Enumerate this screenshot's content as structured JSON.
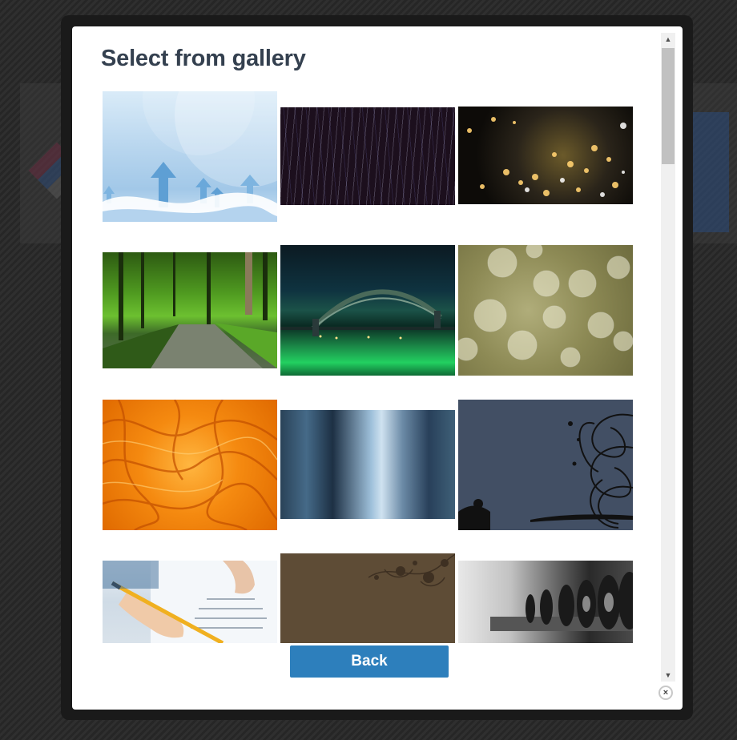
{
  "dialog": {
    "title": "Select from gallery",
    "back_label": "Back",
    "close_icon_glyph": "×"
  },
  "gallery": {
    "images": [
      {
        "subject": "blue-arrows-abstract",
        "icon": "image-icon"
      },
      {
        "subject": "dark-rain-streaks",
        "icon": "image-icon"
      },
      {
        "subject": "city-lights-bokeh-night",
        "icon": "image-icon"
      },
      {
        "subject": "green-forest-path",
        "icon": "image-icon"
      },
      {
        "subject": "harbour-bridge-night-green-water",
        "icon": "image-icon"
      },
      {
        "subject": "olive-bokeh-circles",
        "icon": "image-icon"
      },
      {
        "subject": "orange-abstract-texture",
        "icon": "image-icon"
      },
      {
        "subject": "blue-blurred-stripes",
        "icon": "image-icon"
      },
      {
        "subject": "slate-grunge-swirls",
        "icon": "image-icon"
      },
      {
        "subject": "hand-writing-with-pencil",
        "icon": "image-icon"
      },
      {
        "subject": "brown-floral-corner",
        "icon": "image-icon"
      },
      {
        "subject": "gym-dumbbells-grayscale",
        "icon": "image-icon"
      }
    ]
  },
  "scrollbar": {
    "up_glyph": "▲",
    "down_glyph": "▼",
    "position_fraction": 0.0
  },
  "colors": {
    "primary_button": "#2d7fbc",
    "title_text": "#34404f",
    "overlay_frame": "#1a1a1a"
  }
}
